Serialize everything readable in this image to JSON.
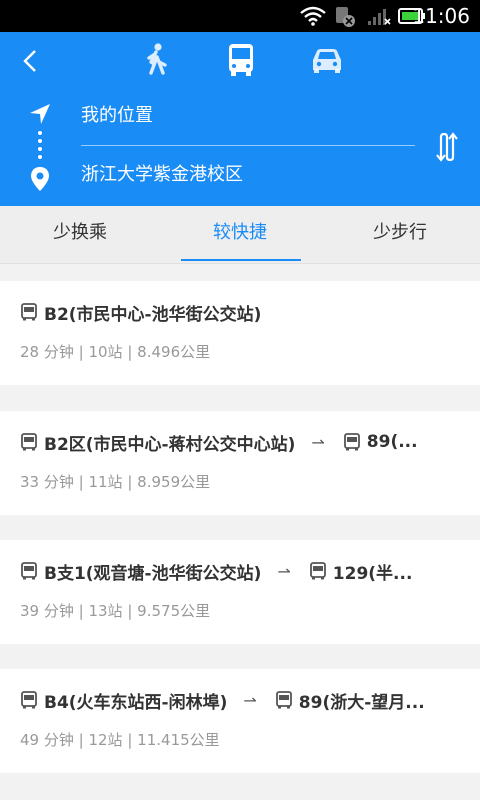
{
  "status_bar": {
    "time": "11:06",
    "icons": [
      "wifi-icon",
      "sim-disabled-icon",
      "signal-icon",
      "battery-icon"
    ]
  },
  "header": {
    "modes": [
      "walk-icon",
      "bus-icon",
      "car-icon"
    ],
    "active_mode": "bus",
    "from": "我的位置",
    "to": "浙江大学紫金港校区",
    "accent": "#1a8cf6"
  },
  "tabs": [
    "少换乘",
    "较快捷",
    "少步行"
  ],
  "active_tab": 1,
  "routes": [
    {
      "line1": "B2(市民中心-池华街公交站)",
      "line2": "",
      "duration": "28 分钟",
      "stops": "10站",
      "distance": "8.496公里"
    },
    {
      "line1": "B2区(市民中心-蒋村公交中心站)",
      "line2": "89(...",
      "duration": "33 分钟",
      "stops": "11站",
      "distance": "8.959公里"
    },
    {
      "line1": "B支1(观音塘-池华街公交站)",
      "line2": "129(半...",
      "duration": "39 分钟",
      "stops": "13站",
      "distance": "9.575公里"
    },
    {
      "line1": "B4(火车东站西-闲林埠)",
      "line2": "89(浙大-望月...",
      "duration": "49 分钟",
      "stops": "12站",
      "distance": "11.415公里"
    }
  ]
}
